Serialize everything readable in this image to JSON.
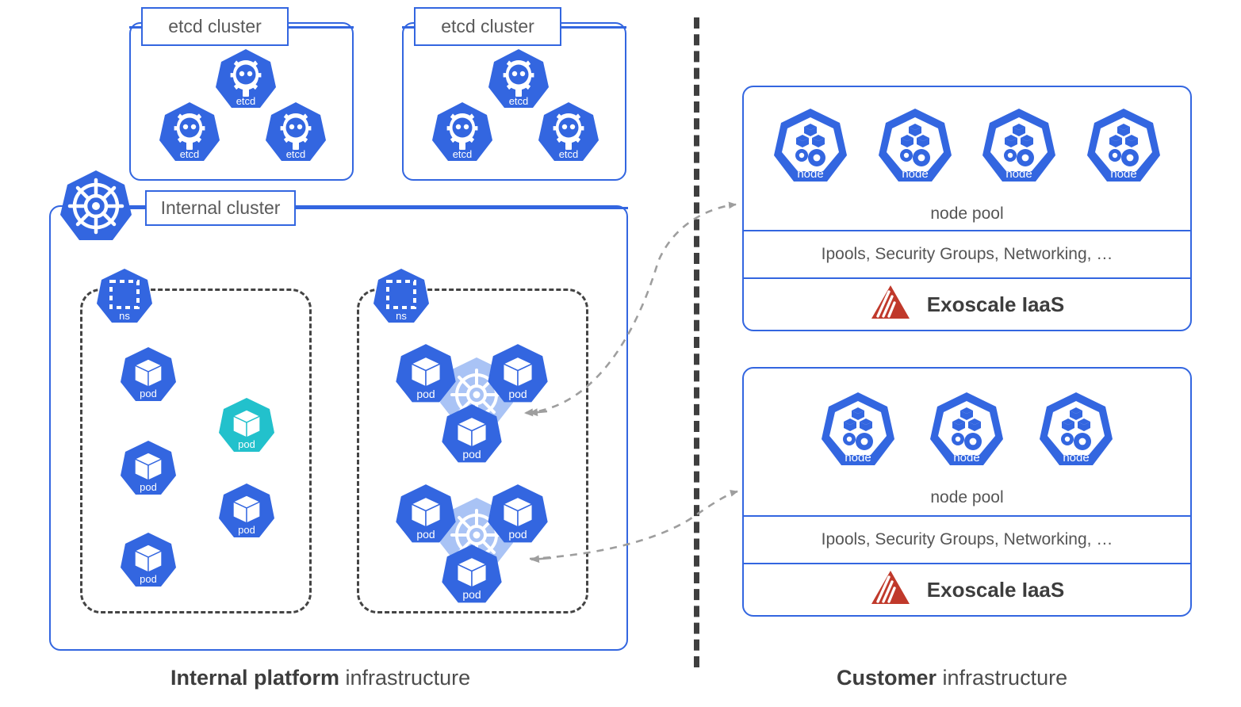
{
  "meta": {
    "colors": {
      "k8s_blue": "#3366E0",
      "k8s_blue_light": "#A9C3F5",
      "pod_teal": "#22C1CC",
      "exoscale_red": "#C0392B",
      "divider_gray": "#3f3f3f",
      "arrow_gray": "#9e9e9e",
      "text_gray": "#555555"
    }
  },
  "left": {
    "caption_bold": "Internal platform",
    "caption_rest": " infrastructure",
    "etcd_clusters": [
      {
        "label": "etcd cluster",
        "members": [
          {
            "label": "etcd"
          },
          {
            "label": "etcd"
          },
          {
            "label": "etcd"
          }
        ]
      },
      {
        "label": "etcd cluster",
        "members": [
          {
            "label": "etcd"
          },
          {
            "label": "etcd"
          },
          {
            "label": "etcd"
          }
        ]
      }
    ],
    "internal_cluster": {
      "label": "Internal cluster",
      "namespaces": [
        {
          "badge_label": "ns",
          "pods": [
            {
              "label": "pod",
              "color": "blue"
            },
            {
              "label": "pod",
              "color": "blue"
            },
            {
              "label": "pod",
              "color": "blue"
            },
            {
              "label": "pod",
              "color": "teal"
            },
            {
              "label": "pod",
              "color": "blue"
            }
          ]
        },
        {
          "badge_label": "ns",
          "pod_groups": [
            {
              "pods": [
                {
                  "label": "pod"
                },
                {
                  "label": "pod"
                },
                {
                  "label": "pod"
                }
              ]
            },
            {
              "pods": [
                {
                  "label": "pod"
                },
                {
                  "label": "pod"
                },
                {
                  "label": "pod"
                }
              ]
            }
          ]
        }
      ]
    }
  },
  "right": {
    "caption_bold": "Customer",
    "caption_rest": " infrastructure",
    "panels": [
      {
        "nodes": [
          {
            "label": "node"
          },
          {
            "label": "node"
          },
          {
            "label": "node"
          },
          {
            "label": "node"
          }
        ],
        "pool_label": "node pool",
        "infra_label": "Ipools, Security Groups, Networking, …",
        "iaas_label": "Exoscale IaaS"
      },
      {
        "nodes": [
          {
            "label": "node"
          },
          {
            "label": "node"
          },
          {
            "label": "node"
          }
        ],
        "pool_label": "node pool",
        "infra_label": "Ipools, Security Groups, Networking, …",
        "iaas_label": "Exoscale IaaS"
      }
    ]
  }
}
